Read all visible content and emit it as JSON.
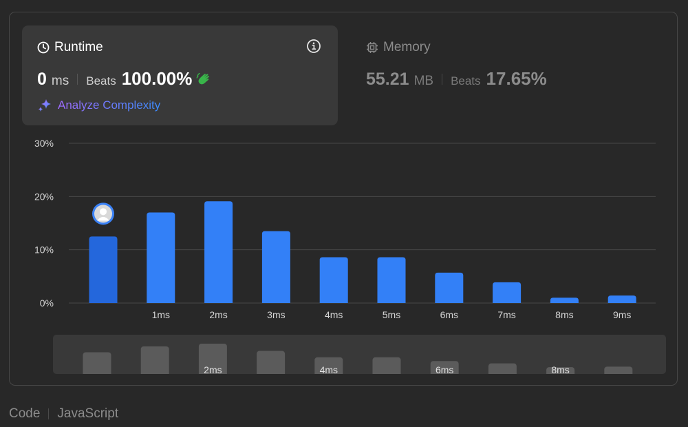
{
  "runtime": {
    "title": "Runtime",
    "value": "0",
    "unit": "ms",
    "beats_label": "Beats",
    "beats_pct": "100.00%",
    "analyze_label": "Analyze Complexity"
  },
  "memory": {
    "title": "Memory",
    "value": "55.21",
    "unit": "MB",
    "beats_label": "Beats",
    "beats_pct": "17.65%"
  },
  "chart_data": {
    "type": "bar",
    "ytick_labels": [
      "30%",
      "20%",
      "10%",
      "0%"
    ],
    "ylim": [
      0,
      30
    ],
    "categories": [
      "",
      "1ms",
      "2ms",
      "3ms",
      "4ms",
      "5ms",
      "6ms",
      "7ms",
      "8ms",
      "9ms"
    ],
    "values": [
      12.5,
      17.0,
      19.1,
      13.5,
      8.6,
      8.6,
      5.7,
      3.9,
      1.0,
      1.4
    ],
    "highlight_index": 0,
    "grid": true,
    "colors": {
      "bar": "#3380f7",
      "bar_highlight": "#2467dc",
      "grid": "#474747"
    }
  },
  "minimap": {
    "labels": [
      "",
      "",
      "2ms",
      "",
      "4ms",
      "",
      "6ms",
      "",
      "8ms",
      ""
    ],
    "values": [
      12.5,
      17.0,
      19.1,
      13.5,
      8.6,
      8.6,
      5.7,
      3.9,
      1.0,
      1.4
    ]
  },
  "footer": {
    "code_label": "Code",
    "language": "JavaScript"
  }
}
